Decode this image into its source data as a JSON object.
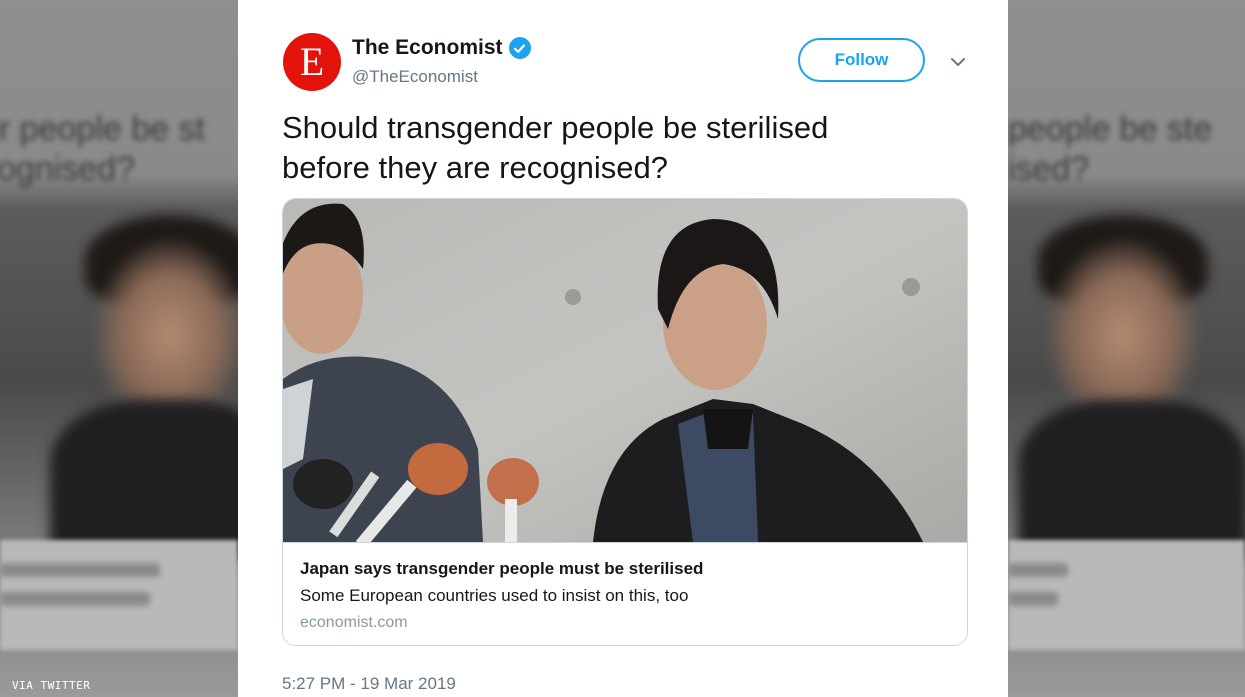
{
  "tweet": {
    "display_name": "The Economist",
    "handle": "@TheEconomist",
    "avatar_letter": "E",
    "follow_label": "Follow",
    "text_line1": "Should transgender people be sterilised",
    "text_line2": "before they are recognised?",
    "timestamp": "5:27 PM - 19 Mar 2019"
  },
  "link_card": {
    "title": "Japan says transgender people must be sterilised",
    "description": "Some European countries used to insist on this, too",
    "domain": "economist.com"
  },
  "credit": "VIA TWITTER",
  "colors": {
    "brand_red": "#e3120b",
    "twitter_blue": "#1da1f2",
    "secondary_text": "#657786"
  },
  "icons": [
    "verified-badge-icon",
    "chevron-down-icon"
  ]
}
